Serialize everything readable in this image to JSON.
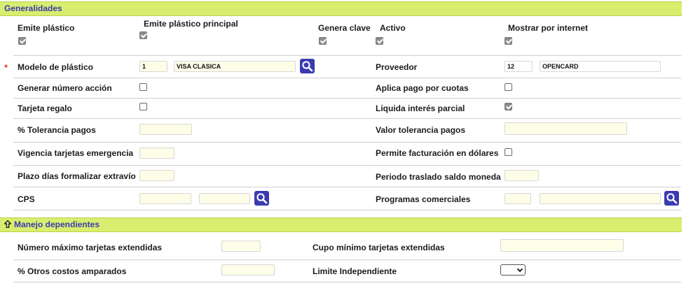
{
  "generalidades": {
    "title": "Generalidades",
    "emite_plastico": "Emite plástico",
    "emite_plastico_principal": "Emite plástico principal",
    "genera_clave": "Genera clave",
    "activo": "Activo",
    "mostrar_internet": "Mostrar por internet",
    "modelo_plastico": {
      "label": "Modelo de plástico",
      "code": "1",
      "name": "VISA CLASICA"
    },
    "proveedor": {
      "label": "Proveedor",
      "code": "12",
      "name": "OPENCARD"
    },
    "generar_numero_accion": "Generar número acción",
    "aplica_pago_cuotas": "Aplica pago por cuotas",
    "tarjeta_regalo": "Tarjeta regalo",
    "liquida_interes_parcial": "Liquida interés parcial",
    "tolerancia_pagos": "% Tolerancia pagos",
    "valor_tolerancia_pagos": "Valor tolerancia pagos",
    "vigencia_tarjetas": "Vigencia tarjetas emergencia",
    "permite_facturacion": "Permite facturación en dólares",
    "plazo_dias": "Plazo días formalizar extravío",
    "periodo_traslado": "Periodo traslado saldo moneda",
    "cps": "CPS",
    "programas_comerciales": "Programas comerciales"
  },
  "manejo": {
    "title": "Manejo dependientes",
    "numero_maximo": "Número máximo tarjetas extendidas",
    "cupo_minimo": "Cupo mínimo tarjetas extendidas",
    "otros_costos": "% Otros costos amparados",
    "limite_independiente": "Limite Independiente"
  },
  "required_mark": "*",
  "colors": {
    "header_bg": "#d9ee6e",
    "header_text": "#3a3ab0",
    "search_button": "#3b3bb0"
  }
}
